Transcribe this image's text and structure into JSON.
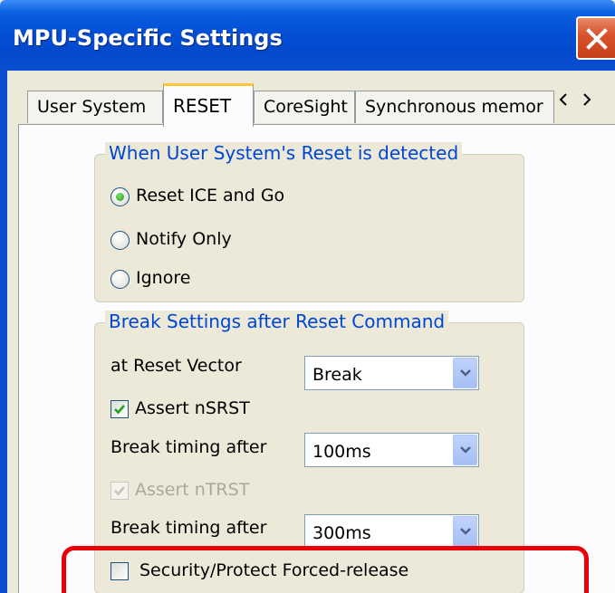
{
  "window": {
    "title": "MPU-Specific Settings"
  },
  "tabs": [
    {
      "label": "User System",
      "active": false
    },
    {
      "label": "RESET",
      "active": true
    },
    {
      "label": "CoreSight",
      "active": false
    },
    {
      "label": "Synchronous memor",
      "active": false
    }
  ],
  "reset_group": {
    "caption": "When User System's Reset is detected",
    "options": [
      {
        "label": "Reset ICE and Go",
        "selected": true
      },
      {
        "label": "Notify Only",
        "selected": false
      },
      {
        "label": "Ignore",
        "selected": false
      }
    ]
  },
  "break_group": {
    "caption": "Break Settings after Reset Command",
    "at_reset_vector_label": "at Reset Vector",
    "at_reset_vector_value": "Break",
    "assert_nsrst_label": "Assert nSRST",
    "assert_nsrst_checked": true,
    "break_timing_1_label": "Break timing after",
    "break_timing_1_value": "100ms",
    "assert_ntrst_label": "Assert nTRST",
    "assert_ntrst_checked": true,
    "assert_ntrst_enabled": false,
    "break_timing_2_label": "Break timing after",
    "break_timing_2_value": "300ms",
    "security_label": "Security/Protect Forced-release",
    "security_checked": false
  },
  "colors": {
    "titlebar": "#0550d6",
    "group_caption": "#0046d5",
    "highlight": "#e8000b",
    "radio_dot": "#21a121",
    "check_mark": "#21a121"
  },
  "icons": {
    "close": "close-icon",
    "tab_scroll_left": "chevron-left-icon",
    "tab_scroll_right": "chevron-right-icon",
    "dropdown": "chevron-down-icon",
    "check": "check-icon"
  }
}
